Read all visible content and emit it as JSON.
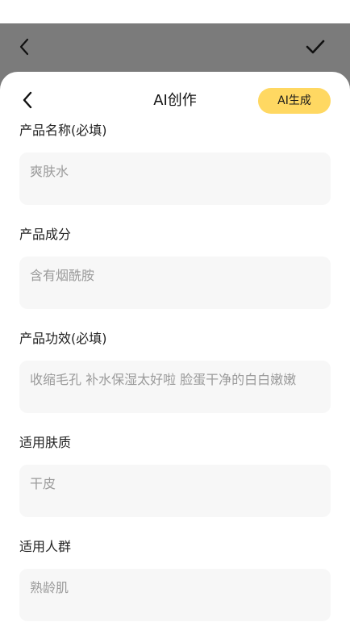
{
  "header": {
    "title": "AI创作",
    "generate_button": "AI生成"
  },
  "fields": [
    {
      "label": "产品名称(必填)",
      "value": "爽肤水"
    },
    {
      "label": "产品成分",
      "value": "含有烟酰胺"
    },
    {
      "label": "产品功效(必填)",
      "value": "收缩毛孔 补水保湿太好啦 脸蛋干净的白白嫩嫩"
    },
    {
      "label": "适用肤质",
      "value": "干皮"
    },
    {
      "label": "适用人群",
      "value": "熟龄肌"
    }
  ],
  "icons": {
    "background_back": "chevron-left-icon",
    "background_confirm": "check-icon",
    "sheet_back": "chevron-left-icon"
  },
  "colors": {
    "accent": "#ffd862",
    "field_background": "#f7f7f7",
    "overlay": "#7b7b7b"
  }
}
